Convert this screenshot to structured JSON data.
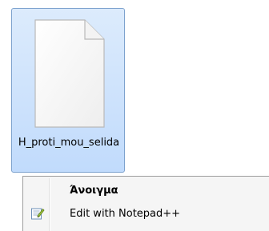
{
  "file": {
    "name": "H_proti_mou_selida",
    "icon": "blank-document-icon"
  },
  "context_menu": {
    "items": [
      {
        "label": "Άνοιγμα",
        "bold": true,
        "icon": ""
      },
      {
        "label": "Edit with Notepad++",
        "bold": false,
        "icon": "notepad-plus-plus-icon"
      }
    ]
  },
  "colors": {
    "selection_border": "#7da2ce",
    "selection_fill": "#c1dbfc",
    "menu_background": "#f5f5f5"
  }
}
